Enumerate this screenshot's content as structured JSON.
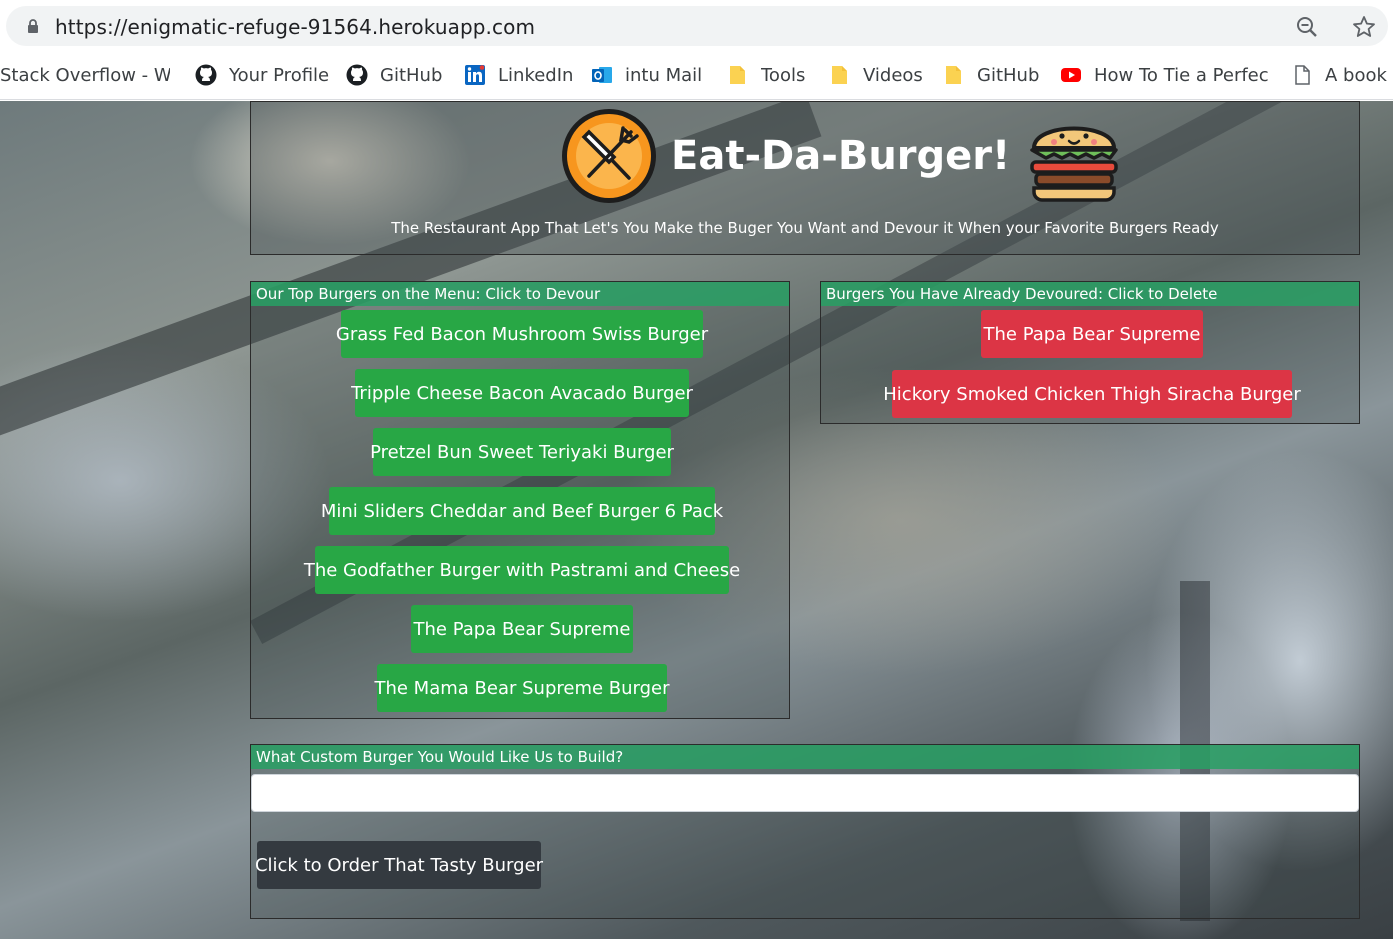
{
  "browser": {
    "url": "https://enigmatic-refuge-91564.herokuapp.com",
    "bookmarks": [
      {
        "label": "Stack Overflow - Whe",
        "icon": "none"
      },
      {
        "label": "Your Profile",
        "icon": "github-icon"
      },
      {
        "label": "GitHub",
        "icon": "github-icon"
      },
      {
        "label": "LinkedIn",
        "icon": "linkedin-icon"
      },
      {
        "label": "intu Mail",
        "icon": "outlook-icon"
      },
      {
        "label": "Tools",
        "icon": "folder-icon"
      },
      {
        "label": "Videos",
        "icon": "folder-icon"
      },
      {
        "label": "GitHub",
        "icon": "folder-icon"
      },
      {
        "label": "How To Tie a Perfect",
        "icon": "youtube-icon"
      },
      {
        "label": "A book c",
        "icon": "page-icon"
      }
    ]
  },
  "header": {
    "title": "Eat-Da-Burger!",
    "subtitle": "The Restaurant App That Let's You Make the Buger You Want and Devour it When your Favorite Burgers Ready"
  },
  "menu": {
    "heading": "Our Top Burgers on the Menu: Click to Devour",
    "burgers": [
      "Grass Fed Bacon Mushroom Swiss Burger",
      "Tripple Cheese Bacon Avacado Burger",
      "Pretzel Bun Sweet Teriyaki Burger",
      "Mini Sliders Cheddar and Beef Burger 6 Pack",
      "The Godfather Burger with Pastrami and Cheese",
      "The Papa Bear Supreme",
      "The Mama Bear Supreme Burger"
    ]
  },
  "devoured": {
    "heading": "Burgers You Have Already Devoured: Click to Delete",
    "burgers": [
      "The Papa Bear Supreme",
      "Hickory Smoked Chicken Thigh Siracha Burger"
    ]
  },
  "custom": {
    "heading": "What Custom Burger You Would Like Us to Build?",
    "input_value": "",
    "input_placeholder": "",
    "submit_label": "Click to Order That Tasty Burger"
  },
  "colors": {
    "green_button": "#28a745",
    "red_button": "#dc3545",
    "dark_button": "#343a40",
    "section_header": "#28a064"
  }
}
